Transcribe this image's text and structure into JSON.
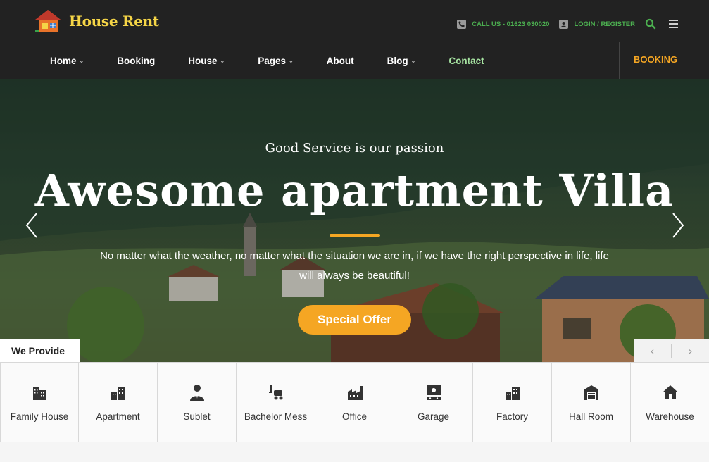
{
  "brand": {
    "name": "House Rent"
  },
  "topbar": {
    "call_label": "CALL US - 01623 030020",
    "login_label": "LOGIN / REGISTER"
  },
  "nav": {
    "items": [
      {
        "label": "Home",
        "dropdown": true
      },
      {
        "label": "Booking",
        "dropdown": false
      },
      {
        "label": "House",
        "dropdown": true
      },
      {
        "label": "Pages",
        "dropdown": true
      },
      {
        "label": "About",
        "dropdown": false
      },
      {
        "label": "Blog",
        "dropdown": true
      },
      {
        "label": "Contact",
        "dropdown": false
      }
    ],
    "booking_cta": "BOOKING"
  },
  "hero": {
    "subtitle": "Good Service is our passion",
    "title": "Awesome apartment Villa",
    "description_line1": "No matter what the weather, no matter what the situation we are in, if we have the right perspective in life, life",
    "description_line2": "will always be beautiful!",
    "button_label": "Special Offer"
  },
  "provide": {
    "heading": "We Provide",
    "items": [
      {
        "label": "Family House",
        "icon": "building-icon"
      },
      {
        "label": "Apartment",
        "icon": "apartment-icon"
      },
      {
        "label": "Sublet",
        "icon": "person-icon"
      },
      {
        "label": "Bachelor Mess",
        "icon": "bachelor-icon"
      },
      {
        "label": "Office",
        "icon": "office-icon"
      },
      {
        "label": "Garage",
        "icon": "garage-icon"
      },
      {
        "label": "Factory",
        "icon": "factory-icon"
      },
      {
        "label": "Hall Room",
        "icon": "hall-room-icon"
      },
      {
        "label": "Warehouse",
        "icon": "warehouse-icon"
      }
    ]
  },
  "colors": {
    "header_bg": "#222222",
    "accent": "#f5a623",
    "logo_text": "#f5d547",
    "topbar_text": "#4caf50",
    "contact_link": "#a6e3a1"
  }
}
